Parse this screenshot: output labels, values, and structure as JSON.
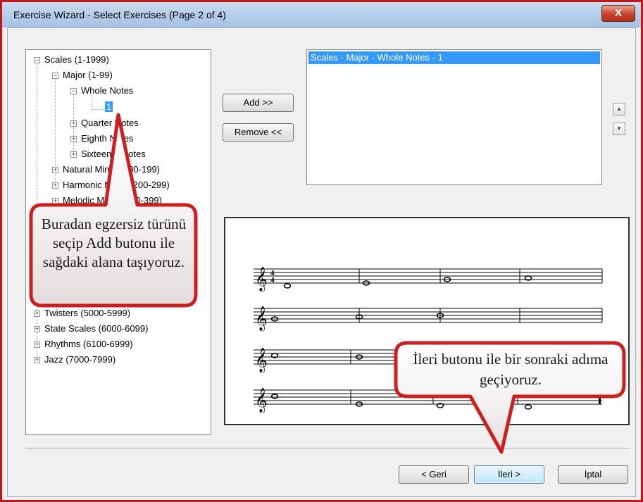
{
  "window": {
    "title": "Exercise Wizard - Select Exercises (Page 2 of 4)",
    "close_label": "X"
  },
  "tree": {
    "items": [
      {
        "label": "Scales (1-1999)",
        "state": "expanded"
      },
      {
        "label": "Major (1-99)",
        "state": "expanded"
      },
      {
        "label": "Whole Notes",
        "state": "expanded"
      },
      {
        "label": "1",
        "state": "leaf",
        "selected": true
      },
      {
        "label": "Quarter Notes",
        "state": "collapsed"
      },
      {
        "label": "Eighth Notes",
        "state": "collapsed"
      },
      {
        "label": "Sixteenth Notes",
        "state": "collapsed"
      },
      {
        "label": "Natural Minor (100-199)",
        "state": "collapsed"
      },
      {
        "label": "Harmonic Minor (200-299)",
        "state": "collapsed"
      },
      {
        "label": "Melodic Minor (300-399)",
        "state": "collapsed"
      },
      {
        "label": "Twisters (5000-5999)",
        "state": "collapsed"
      },
      {
        "label": "State Scales (6000-6099)",
        "state": "collapsed"
      },
      {
        "label": "Rhythms (6100-6999)",
        "state": "collapsed"
      },
      {
        "label": "Jazz (7000-7999)",
        "state": "collapsed"
      }
    ]
  },
  "buttons": {
    "add": "Add >>",
    "remove": "Remove <<",
    "back": "< Geri",
    "next": "İleri >",
    "cancel": "İptal"
  },
  "selected_list": {
    "items": [
      "Scales  - Major  - Whole Notes - 1"
    ]
  },
  "callouts": {
    "left": "Buradan egzersiz türünü seçip Add butonu ile sağdaki alana taşıyoruz.",
    "right": "İleri butonu ile bir sonraki adıma geçiyoruz."
  },
  "colors": {
    "selection": "#3399ff",
    "callout_border": "#cc1f1f",
    "window_border": "#c01818"
  }
}
